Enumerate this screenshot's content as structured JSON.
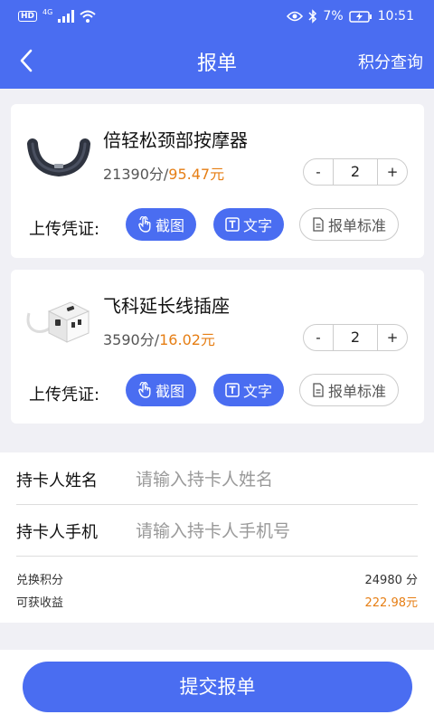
{
  "status_bar": {
    "left_badge": "HD",
    "network": "4G",
    "battery_percent": "7%",
    "time": "10:51",
    "icons": [
      "signal-icon",
      "wifi-icon",
      "eye-icon",
      "bluetooth-icon",
      "battery-charging-icon"
    ]
  },
  "nav": {
    "title": "报单",
    "right_link": "积分查询",
    "back_icon": "chevron-left-icon"
  },
  "products": [
    {
      "name": "倍轻松颈部按摩器",
      "points": "21390分/",
      "money": "95.47元",
      "quantity": "2",
      "stepper_minus": "-",
      "stepper_plus": "+",
      "upload_label": "上传凭证:",
      "btn_screenshot": "截图",
      "btn_text": "文字",
      "btn_standard": "报单标准",
      "image_icon": "neck-massager-image"
    },
    {
      "name": "飞科延长线插座",
      "points": "3590分/",
      "money": "16.02元",
      "quantity": "2",
      "stepper_minus": "-",
      "stepper_plus": "+",
      "upload_label": "上传凭证:",
      "btn_screenshot": "截图",
      "btn_text": "文字",
      "btn_standard": "报单标准",
      "image_icon": "power-strip-image"
    }
  ],
  "form": {
    "name_label": "持卡人姓名",
    "name_placeholder": "请输入持卡人姓名",
    "phone_label": "持卡人手机",
    "phone_placeholder": "请输入持卡人手机号"
  },
  "summary": {
    "points_label": "兑换积分",
    "points_value": "24980 分",
    "earnings_label": "可获收益",
    "earnings_value": "222.98元"
  },
  "submit_label": "提交报单",
  "colors": {
    "primary": "#4a6df1",
    "money": "#e67e14",
    "background": "#f0f0f5"
  }
}
